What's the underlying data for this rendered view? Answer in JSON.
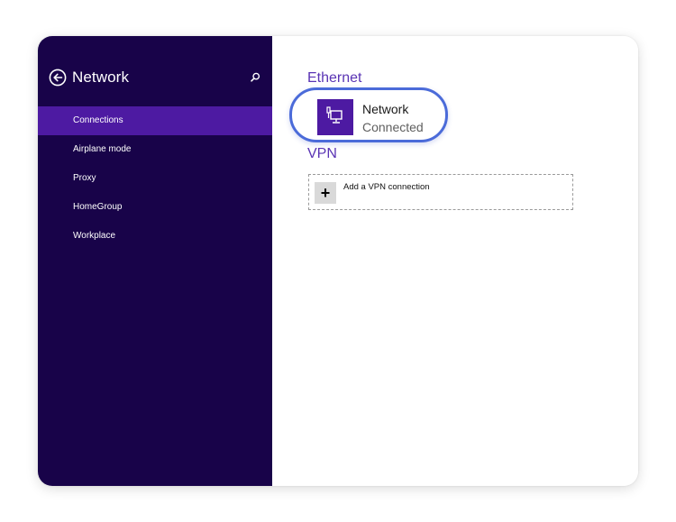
{
  "sidebar": {
    "title": "Network",
    "back_icon": "back-arrow-icon",
    "search_icon": "search-icon",
    "items": [
      {
        "label": "Connections",
        "selected": true
      },
      {
        "label": "Airplane mode",
        "selected": false
      },
      {
        "label": "Proxy",
        "selected": false
      },
      {
        "label": "HomeGroup",
        "selected": false
      },
      {
        "label": "Workplace",
        "selected": false
      }
    ]
  },
  "main": {
    "ethernet": {
      "heading": "Ethernet",
      "network": {
        "name": "Network",
        "status": "Connected",
        "icon": "ethernet-icon"
      }
    },
    "vpn": {
      "heading": "VPN",
      "add_label": "Add a VPN connection",
      "add_icon": "plus-icon"
    }
  },
  "colors": {
    "sidebar_bg": "#180349",
    "selected_item_bg": "#4d1aa2",
    "accent_text": "#5a34b4",
    "highlight_ring": "#4b6bd9"
  }
}
